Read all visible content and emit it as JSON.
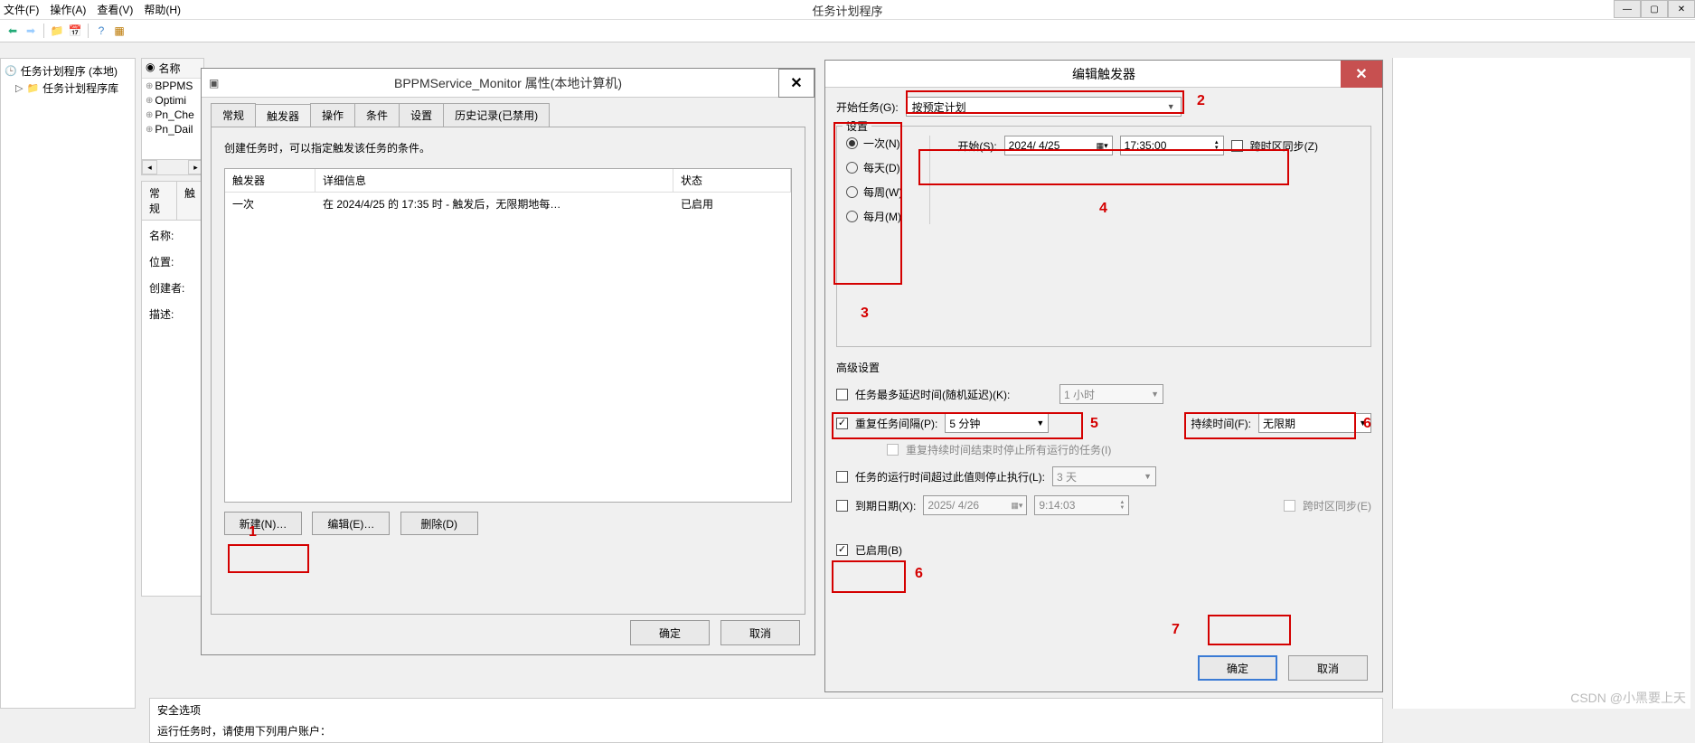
{
  "app": {
    "title": "任务计划程序",
    "menu": {
      "file": "文件(F)",
      "action": "操作(A)",
      "view": "查看(V)",
      "help": "帮助(H)"
    }
  },
  "tree": {
    "root": "任务计划程序 (本地)",
    "child": "任务计划程序库"
  },
  "task_list": {
    "col_name": "名称",
    "items": [
      "BPPMS",
      "Optimi",
      "Pn_Che",
      "Pn_Dail"
    ]
  },
  "detail_tabs": {
    "general": "常规",
    "trigger_short": "触"
  },
  "detail_labels": {
    "name": "名称:",
    "location": "位置:",
    "author": "创建者:",
    "description": "描述:"
  },
  "security_label": "安全选项",
  "security_sub": "运行任务时，请使用下列用户账户：",
  "props": {
    "title": "BPPMService_Monitor 属性(本地计算机)",
    "tabs": {
      "general": "常规",
      "triggers": "触发器",
      "actions": "操作",
      "conditions": "条件",
      "settings": "设置",
      "history": "历史记录(已禁用)"
    },
    "intro": "创建任务时，可以指定触发该任务的条件。",
    "table": {
      "h_trigger": "触发器",
      "h_detail": "详细信息",
      "h_status": "状态",
      "r_trigger": "一次",
      "r_detail": "在 2024/4/25 的 17:35 时 - 触发后，无限期地每…",
      "r_status": "已启用"
    },
    "buttons": {
      "new": "新建(N)…",
      "edit": "编辑(E)…",
      "delete": "删除(D)"
    },
    "ok": "确定",
    "cancel": "取消"
  },
  "edit": {
    "title": "编辑触发器",
    "begin_label": "开始任务(G):",
    "begin_value": "按预定计划",
    "settings_legend": "设置",
    "radios": {
      "once": "一次(N)",
      "daily": "每天(D)",
      "weekly": "每周(W)",
      "monthly": "每月(M)"
    },
    "start_label": "开始(S):",
    "start_date": "2024/ 4/25",
    "start_time": "17:35:00",
    "tz_sync": "跨时区同步(Z)",
    "advanced": "高级设置",
    "delay_label": "任务最多延迟时间(随机延迟)(K):",
    "delay_value": "1 小时",
    "repeat_label": "重复任务间隔(P):",
    "repeat_value": "5 分钟",
    "duration_label": "持续时间(F):",
    "duration_value": "无限期",
    "stop_all_label": "重复持续时间结束时停止所有运行的任务(I)",
    "stop_after_label": "任务的运行时间超过此值则停止执行(L):",
    "stop_after_value": "3 天",
    "expire_label": "到期日期(X):",
    "expire_date": "2025/ 4/26",
    "expire_time": "9:14:03",
    "tz_sync_e": "跨时区同步(E)",
    "enabled_label": "已启用(B)",
    "ok": "确定",
    "cancel": "取消"
  },
  "annotations": {
    "a1": "1",
    "a2": "2",
    "a3": "3",
    "a4": "4",
    "a5": "5",
    "a6": "6",
    "a6b": "6",
    "a7": "7"
  },
  "watermark": "CSDN @小黑要上天"
}
